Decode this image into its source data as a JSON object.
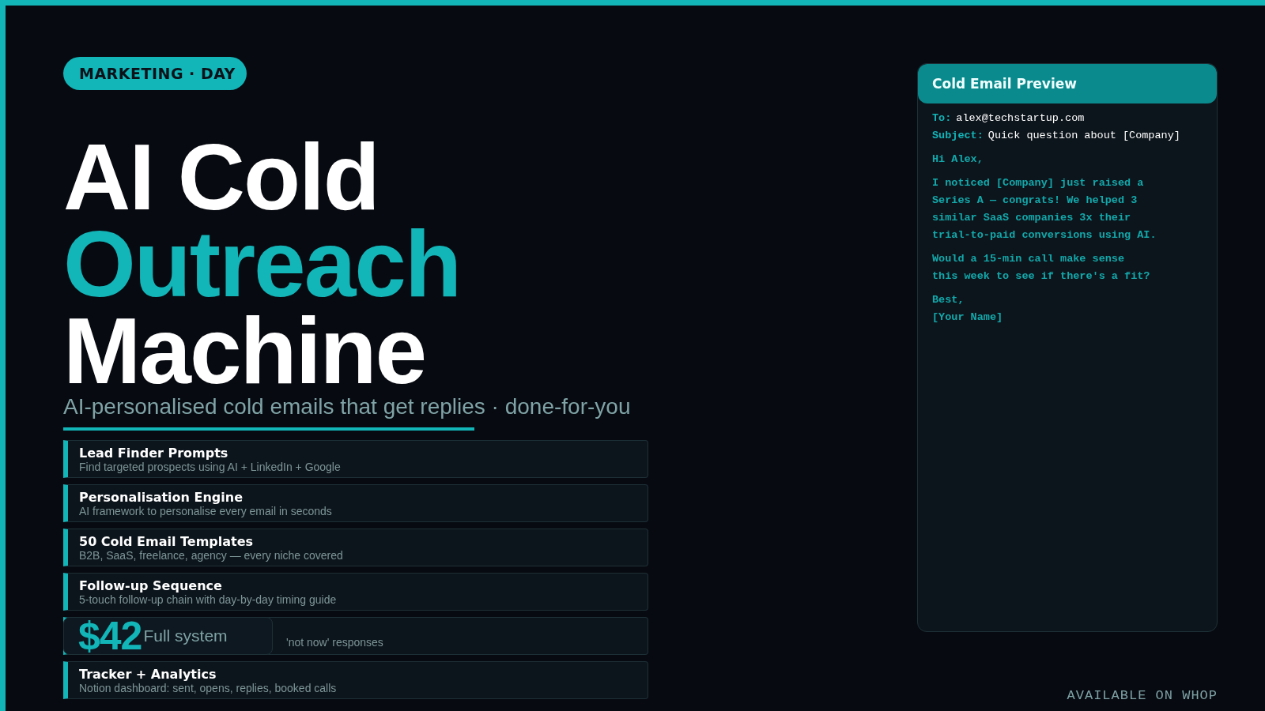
{
  "badge": "MARKETING · DAY",
  "title": {
    "line_1": "AI Cold",
    "line_2": "Outreach",
    "line_3": "Machine"
  },
  "subtitle": "AI-personalised cold emails that get replies · done-for-you",
  "features": [
    {
      "title": "Lead Finder Prompts",
      "description": "Find targeted prospects using AI + LinkedIn + Google"
    },
    {
      "title": "Personalisation Engine",
      "description": "AI framework to personalise every email in seconds"
    },
    {
      "title": "50 Cold Email Templates",
      "description": "B2B, SaaS, freelance, agency — every niche covered"
    },
    {
      "title": "Follow-up Sequence",
      "description": "5-touch follow-up chain with day-by-day timing guide"
    },
    {
      "description": "'not now' responses"
    },
    {
      "title": "Tracker + Analytics",
      "description": "Notion dashboard: sent, opens, replies, booked calls"
    }
  ],
  "price": {
    "amount": "$42",
    "note": "Full system"
  },
  "email_preview": {
    "title": "Cold Email Preview",
    "headers": [
      {
        "label": "To:",
        "value": "alex@techstartup.com"
      },
      {
        "label": "Subject:",
        "value": "Quick question about [Company]"
      }
    ],
    "paragraphs": [
      [
        "Hi Alex,"
      ],
      [
        "I noticed [Company] just raised a",
        "Series A — congrats! We helped 3",
        "similar SaaS companies 3x their",
        "trial-to-paid conversions using AI."
      ],
      [
        "Would a 15-min call make sense",
        "this week to see if there's a fit?"
      ],
      [
        "Best,",
        "[Your Name]"
      ]
    ]
  },
  "footer": "AVAILABLE ON WHOP"
}
